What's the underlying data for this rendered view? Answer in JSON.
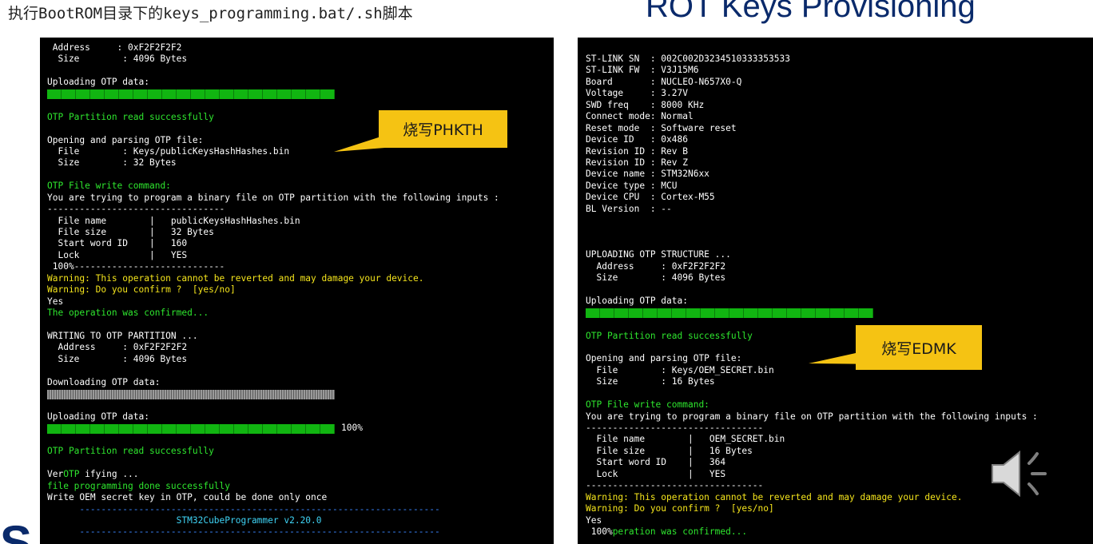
{
  "slide": {
    "caption_cjk_prefix": "执行",
    "caption_mono_1": "BootROM",
    "caption_cjk_mid": "目录下的",
    "caption_mono_2": "keys_programming.bat/.sh",
    "caption_cjk_suffix": "脚本",
    "title": "ROT Keys Provisioning",
    "logo_fragment": "S"
  },
  "colors": {
    "terminal_bg": "#000000",
    "text_white": "#ffffff",
    "text_green": "#2ee62e",
    "text_yellow": "#f5e51c",
    "text_cyan": "#3fd3f5",
    "callout_bg": "#f5c313",
    "title_navy": "#0a2a6b"
  },
  "callouts": {
    "left": "烧写PHKTH",
    "right": "烧写EDMK"
  },
  "terminal_left": {
    "lines": [
      {
        "text": " Address     : 0xF2F2F2F2",
        "color": "white"
      },
      {
        "text": "  Size        : 4096 Bytes",
        "color": "white"
      },
      {
        "text": "",
        "color": "white"
      },
      {
        "text": "Uploading OTP data:",
        "color": "white"
      },
      {
        "progress": 1.0,
        "cells": 20,
        "label": ""
      },
      {
        "text": "",
        "color": "white"
      },
      {
        "text": "OTP Partition read successfully",
        "color": "green"
      },
      {
        "text": "",
        "color": "white"
      },
      {
        "text": "Opening and parsing OTP file:",
        "color": "white"
      },
      {
        "text": "  File        : Keys/publicKeysHashHashes.bin",
        "color": "white"
      },
      {
        "text": "  Size        : 32 Bytes",
        "color": "white"
      },
      {
        "text": "",
        "color": "white"
      },
      {
        "text": "OTP File write command:",
        "color": "green"
      },
      {
        "text": "You are trying to program a binary file on OTP partition with the following inputs :",
        "color": "white"
      },
      {
        "text": "---------------------------------",
        "color": "white"
      },
      {
        "text": "  File name        |   publicKeysHashHashes.bin",
        "color": "white"
      },
      {
        "text": "  File size        |   32 Bytes",
        "color": "white"
      },
      {
        "text": "  Start word ID    |   160",
        "color": "white"
      },
      {
        "text": "  Lock             |   YES",
        "color": "white"
      },
      {
        "text": " 100%----------------------------",
        "color": "white"
      },
      {
        "text": "Warning: This operation cannot be reverted and may damage your device.",
        "color": "yellow"
      },
      {
        "text": "Warning: Do you confirm ?  [yes/no]",
        "color": "yellow"
      },
      {
        "text": "Yes",
        "color": "white"
      },
      {
        "text": "The operation was confirmed...",
        "color": "green"
      },
      {
        "text": "",
        "color": "white"
      },
      {
        "text": "WRITING TO OTP PARTITION ...",
        "color": "white"
      },
      {
        "text": "  Address     : 0xF2F2F2F2",
        "color": "white"
      },
      {
        "text": "  Size        : 4096 Bytes",
        "color": "white"
      },
      {
        "text": "",
        "color": "white"
      },
      {
        "text": "Downloading OTP data:",
        "color": "white"
      },
      {
        "progress": 1.0,
        "cells": 20,
        "label": "",
        "style": "gray"
      },
      {
        "text": "",
        "color": "white"
      },
      {
        "text": "Uploading OTP data:",
        "color": "white"
      },
      {
        "progress": 1.0,
        "cells": 20,
        "label": "100%"
      },
      {
        "text": "",
        "color": "white"
      },
      {
        "text": "OTP Partition read successfully",
        "color": "green"
      },
      {
        "text": "",
        "color": "white"
      },
      {
        "text": "VerOTP ifying ...",
        "color": "mixed_verify"
      },
      {
        "text": "file programming done successfully",
        "color": "green"
      },
      {
        "text": "Write OEM secret key in OTP, could be done only once",
        "color": "white"
      },
      {
        "text": "      -------------------------------------------------------------------",
        "color": "blue"
      },
      {
        "text": "                        STM32CubeProgrammer v2.20.0",
        "color": "cyan"
      },
      {
        "text": "      -------------------------------------------------------------------",
        "color": "blue"
      }
    ]
  },
  "terminal_right": {
    "lines": [
      {
        "text": "ST-LINK SN  : 002C002D3234510333353533",
        "color": "white"
      },
      {
        "text": "ST-LINK FW  : V3J15M6",
        "color": "white"
      },
      {
        "text": "Board       : NUCLEO-N657X0-Q",
        "color": "white"
      },
      {
        "text": "Voltage     : 3.27V",
        "color": "white"
      },
      {
        "text": "SWD freq    : 8000 KHz",
        "color": "white"
      },
      {
        "text": "Connect mode: Normal",
        "color": "white"
      },
      {
        "text": "Reset mode  : Software reset",
        "color": "white"
      },
      {
        "text": "Device ID   : 0x486",
        "color": "white"
      },
      {
        "text": "Revision ID : Rev B",
        "color": "white"
      },
      {
        "text": "Revision ID : Rev Z",
        "color": "white"
      },
      {
        "text": "Device name : STM32N6xx",
        "color": "white"
      },
      {
        "text": "Device type : MCU",
        "color": "white"
      },
      {
        "text": "Device CPU  : Cortex-M55",
        "color": "white"
      },
      {
        "text": "BL Version  : --",
        "color": "white"
      },
      {
        "text": "",
        "color": "white"
      },
      {
        "text": "",
        "color": "white"
      },
      {
        "text": "",
        "color": "white"
      },
      {
        "text": "UPLOADING OTP STRUCTURE ...",
        "color": "white"
      },
      {
        "text": "  Address     : 0xF2F2F2F2",
        "color": "white"
      },
      {
        "text": "  Size        : 4096 Bytes",
        "color": "white"
      },
      {
        "text": "",
        "color": "white"
      },
      {
        "text": "Uploading OTP data:",
        "color": "white"
      },
      {
        "progress": 1.0,
        "cells": 20,
        "label": ""
      },
      {
        "text": "",
        "color": "white"
      },
      {
        "text": "OTP Partition read successfully",
        "color": "green"
      },
      {
        "text": "",
        "color": "white"
      },
      {
        "text": "Opening and parsing OTP file:",
        "color": "white"
      },
      {
        "text": "  File        : Keys/OEM_SECRET.bin",
        "color": "white"
      },
      {
        "text": "  Size        : 16 Bytes",
        "color": "white"
      },
      {
        "text": "",
        "color": "white"
      },
      {
        "text": "OTP File write command:",
        "color": "green"
      },
      {
        "text": "You are trying to program a binary file on OTP partition with the following inputs :",
        "color": "white"
      },
      {
        "text": "---------------------------------",
        "color": "white"
      },
      {
        "text": "  File name        |   OEM_SECRET.bin",
        "color": "white"
      },
      {
        "text": "  File size        |   16 Bytes",
        "color": "white"
      },
      {
        "text": "  Start word ID    |   364",
        "color": "white"
      },
      {
        "text": "  Lock             |   YES",
        "color": "white"
      },
      {
        "text": "---------------------------------",
        "color": "white"
      },
      {
        "text": "Warning: This operation cannot be reverted and may damage your device.",
        "color": "yellow"
      },
      {
        "text": "Warning: Do you confirm ?  [yes/no]",
        "color": "yellow"
      },
      {
        "text": "Yes",
        "color": "white"
      },
      {
        "text": " 100%peration was confirmed...",
        "color": "mixed_confirm"
      }
    ]
  },
  "icons": {
    "speaker": "speaker-volume-icon"
  }
}
